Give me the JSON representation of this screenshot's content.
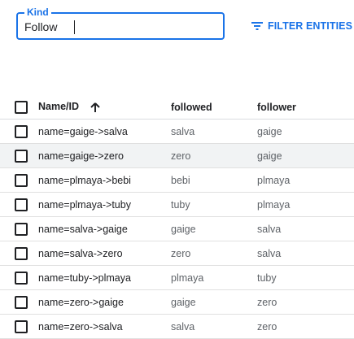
{
  "kind_field": {
    "label": "Kind",
    "value": "Follow"
  },
  "filter_button": {
    "label": "FILTER ENTITIES",
    "icon": "filter-list-icon"
  },
  "table": {
    "columns": {
      "name_id": "Name/ID",
      "followed": "followed",
      "follower": "follower"
    },
    "sort_icon": "arrow-up-icon",
    "rows": [
      {
        "name": "name=gaige->salva",
        "followed": "salva",
        "follower": "gaige"
      },
      {
        "name": "name=gaige->zero",
        "followed": "zero",
        "follower": "gaige"
      },
      {
        "name": "name=plmaya->bebi",
        "followed": "bebi",
        "follower": "plmaya"
      },
      {
        "name": "name=plmaya->tuby",
        "followed": "tuby",
        "follower": "plmaya"
      },
      {
        "name": "name=salva->gaige",
        "followed": "gaige",
        "follower": "salva"
      },
      {
        "name": "name=salva->zero",
        "followed": "zero",
        "follower": "salva"
      },
      {
        "name": "name=tuby->plmaya",
        "followed": "plmaya",
        "follower": "tuby"
      },
      {
        "name": "name=zero->gaige",
        "followed": "gaige",
        "follower": "zero"
      },
      {
        "name": "name=zero->salva",
        "followed": "salva",
        "follower": "zero"
      }
    ]
  },
  "colors": {
    "accent": "#1a73e8",
    "row_highlight": "#f1f3f4",
    "secondary_text": "#5f6368"
  }
}
